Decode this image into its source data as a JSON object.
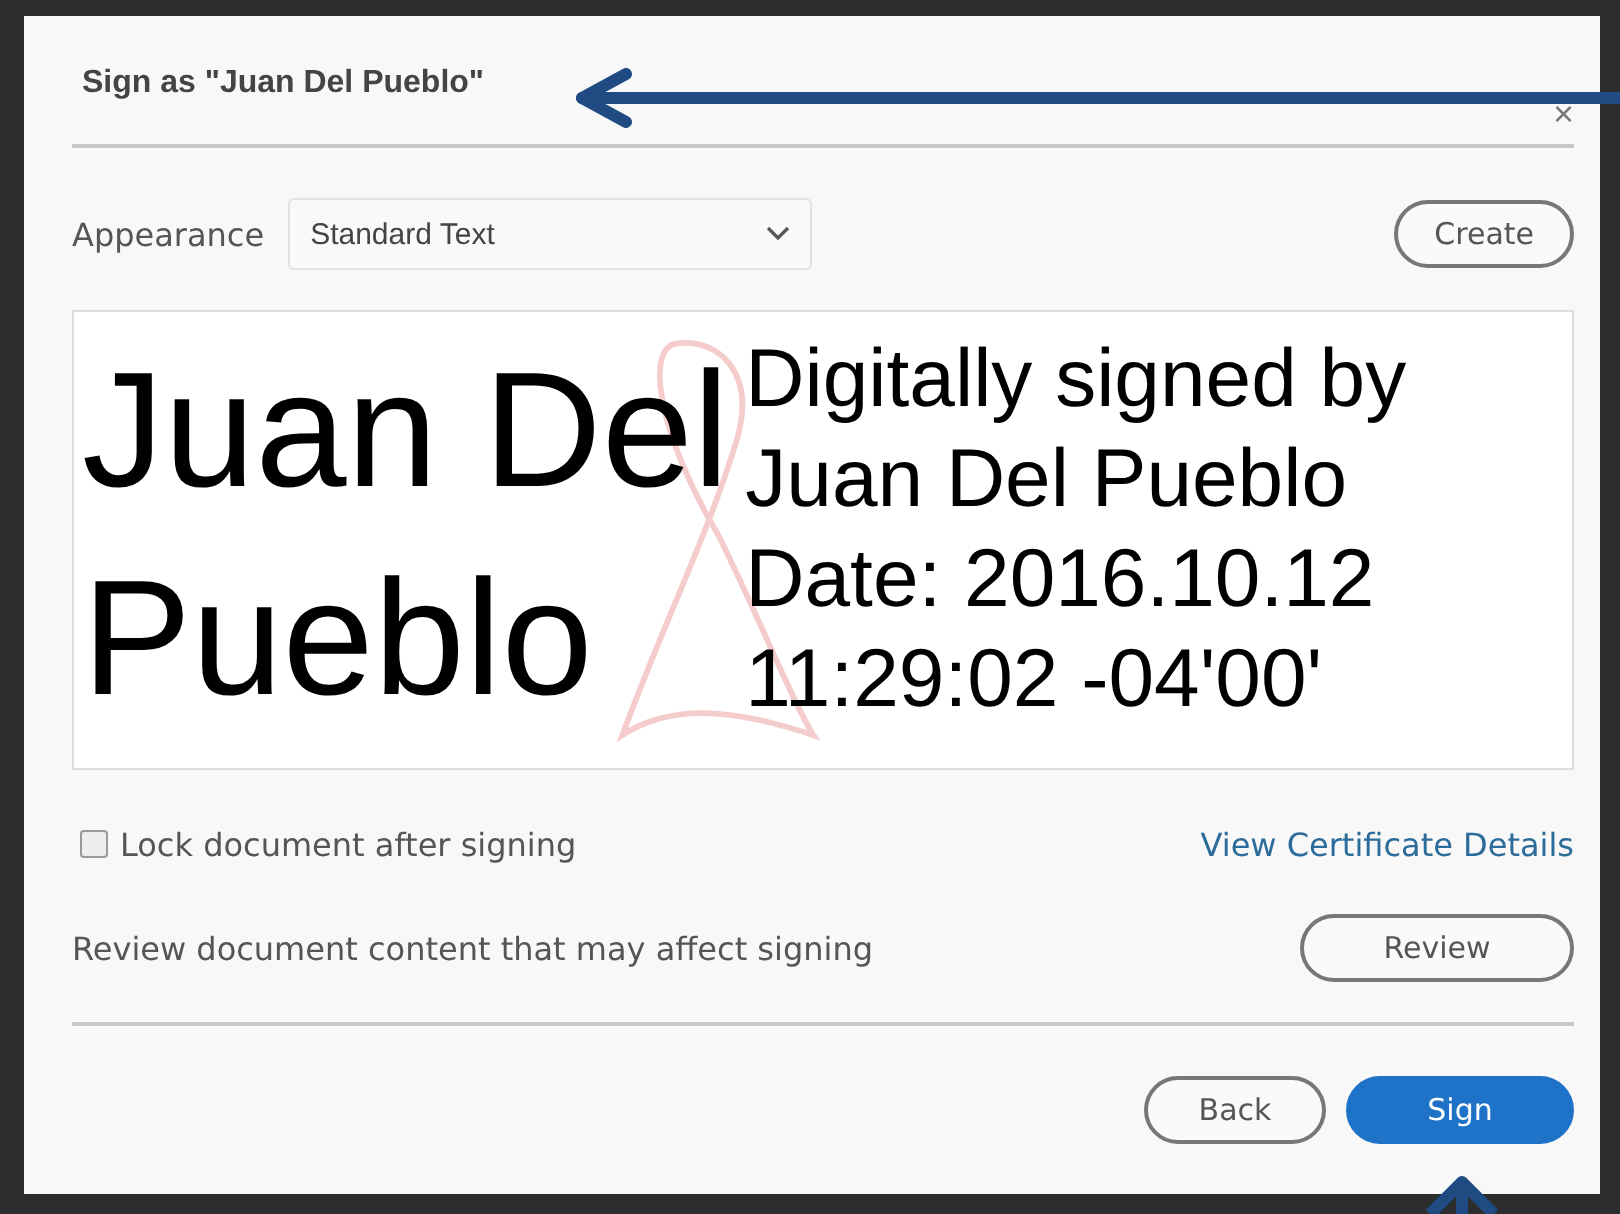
{
  "dialog": {
    "title": "Sign as \"Juan Del Pueblo\"",
    "close": "×"
  },
  "appearance": {
    "label": "Appearance",
    "value": "Standard Text",
    "create_button": "Create"
  },
  "preview": {
    "name_lines": [
      "Juan Del",
      "Pueblo"
    ],
    "details_lines": [
      "Digitally signed by",
      "Juan Del Pueblo",
      "Date: 2016.10.12",
      "11:29:02 -04'00'"
    ]
  },
  "lock": {
    "label": "Lock document after signing",
    "checked": false
  },
  "certificate_link": "View Certificate Details",
  "review": {
    "text": "Review document content that may affect signing",
    "button": "Review"
  },
  "buttons": [
    {
      "label": "Back",
      "kind": "secondary"
    },
    {
      "label": "Sign",
      "kind": "primary"
    }
  ]
}
